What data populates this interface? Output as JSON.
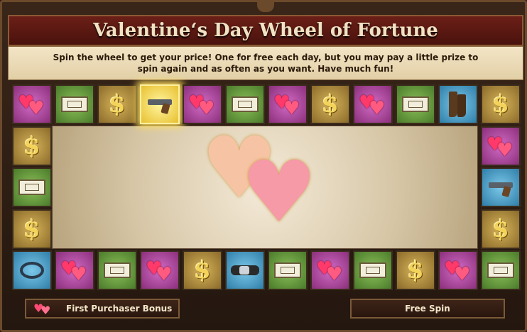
{
  "header": {
    "title": "Valentine‘s Day Wheel of Fortune",
    "description": "Spin the wheel to get your price! One for free each day, but you may pay a little prize to spin again and as often as you want. Have much fun!"
  },
  "board": {
    "active_tile": "top-3",
    "center_prize_icon": "hearts-icon",
    "top_row": [
      {
        "icon": "hearts-icon",
        "color": "pink"
      },
      {
        "icon": "money-bill-icon",
        "color": "green"
      },
      {
        "icon": "dollar-icon",
        "color": "gold"
      },
      {
        "icon": "revolver-icon",
        "color": "blue"
      },
      {
        "icon": "hearts-icon",
        "color": "pink"
      },
      {
        "icon": "money-bill-icon",
        "color": "green"
      },
      {
        "icon": "hearts-icon",
        "color": "pink"
      },
      {
        "icon": "dollar-icon",
        "color": "gold"
      },
      {
        "icon": "hearts-icon",
        "color": "pink"
      },
      {
        "icon": "money-bill-icon",
        "color": "green"
      },
      {
        "icon": "boots-icon",
        "color": "blue"
      },
      {
        "icon": "dollar-icon",
        "color": "gold"
      }
    ],
    "left_column": [
      {
        "icon": "dollar-icon",
        "color": "gold"
      },
      {
        "icon": "money-bill-icon",
        "color": "green"
      },
      {
        "icon": "dollar-icon",
        "color": "gold"
      }
    ],
    "right_column": [
      {
        "icon": "hearts-icon",
        "color": "pink"
      },
      {
        "icon": "revolver-icon",
        "color": "blue"
      },
      {
        "icon": "dollar-icon",
        "color": "gold"
      }
    ],
    "bottom_row": [
      {
        "icon": "lasso-icon",
        "color": "blue"
      },
      {
        "icon": "hearts-icon",
        "color": "pink"
      },
      {
        "icon": "money-bill-icon",
        "color": "green"
      },
      {
        "icon": "hearts-icon",
        "color": "pink"
      },
      {
        "icon": "dollar-icon",
        "color": "gold"
      },
      {
        "icon": "belt-icon",
        "color": "blue"
      },
      {
        "icon": "money-bill-icon",
        "color": "green"
      },
      {
        "icon": "hearts-icon",
        "color": "pink"
      },
      {
        "icon": "money-bill-icon",
        "color": "green"
      },
      {
        "icon": "dollar-icon",
        "color": "gold"
      },
      {
        "icon": "hearts-icon",
        "color": "pink"
      },
      {
        "icon": "money-bill-icon",
        "color": "green"
      }
    ]
  },
  "actions": {
    "first_purchaser_label": "First Purchaser Bonus",
    "free_spin_label": "Free Spin"
  },
  "colors": {
    "title_bg": "#5a1912",
    "parchment": "#ecdcb8",
    "pink_tile": "#b04a9e",
    "green_tile": "#6a9c40",
    "gold_tile": "#b08a3a",
    "blue_tile": "#4a9ec8",
    "highlight": "#ffe060"
  }
}
